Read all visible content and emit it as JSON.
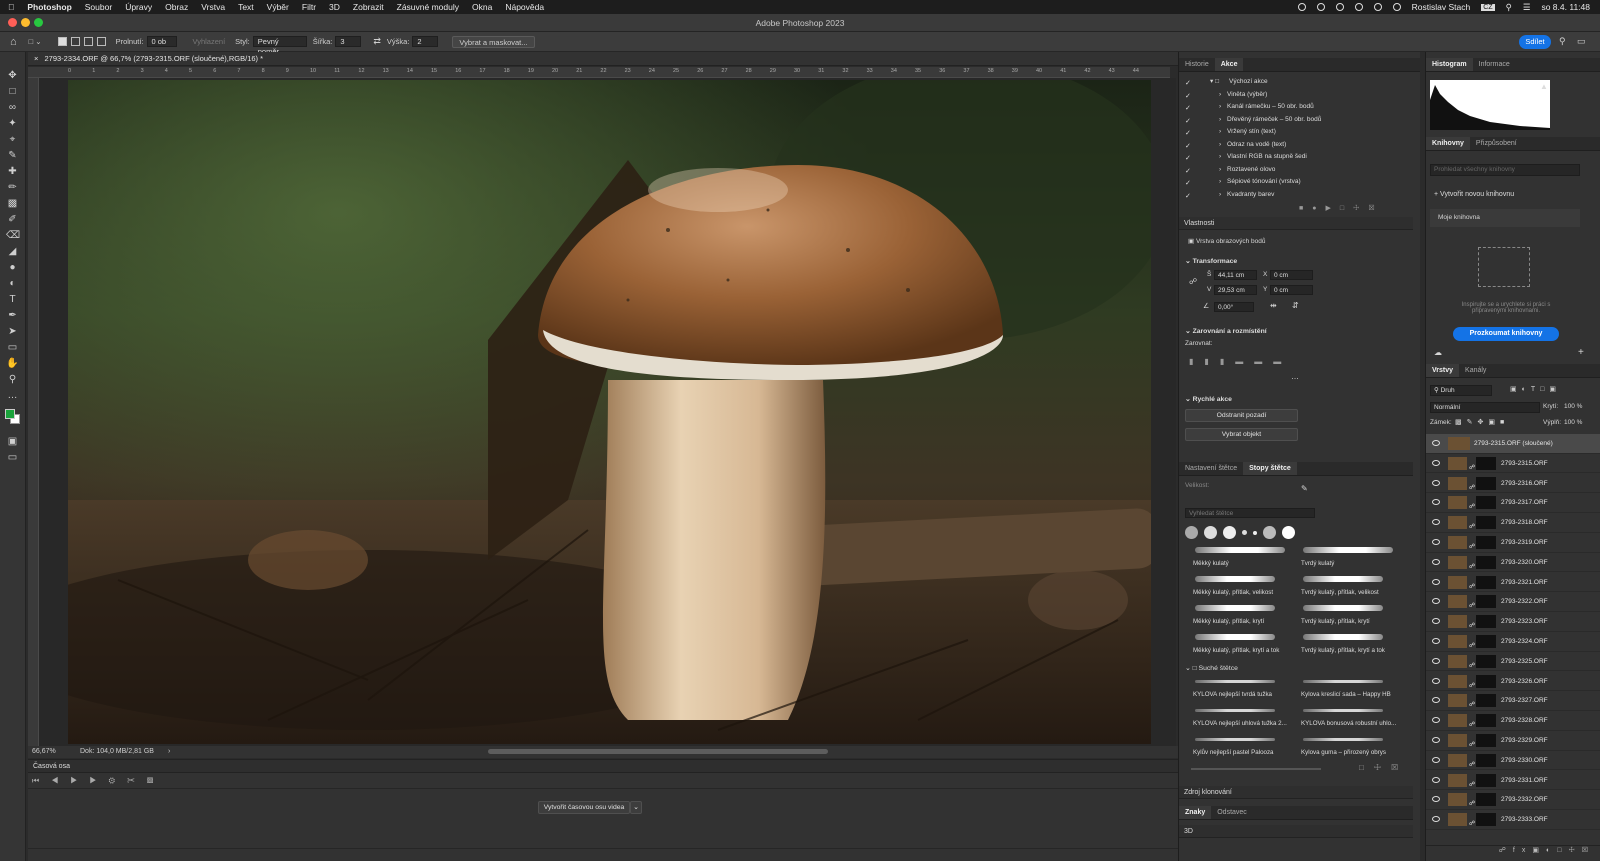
{
  "menubar": {
    "app": "Photoshop",
    "items": [
      "Soubor",
      "Úpravy",
      "Obraz",
      "Vrstva",
      "Text",
      "Výběr",
      "Filtr",
      "3D",
      "Zobrazit",
      "Zásuvné moduly",
      "Okna",
      "Nápověda"
    ],
    "user": "Rostislav Stach",
    "lang": "CZ",
    "datetime": "so 8.4.  11:48"
  },
  "window": {
    "title": "Adobe Photoshop 2023"
  },
  "options": {
    "feather_label": "Prolnutí:",
    "feather_value": "0 ob",
    "antialias_label": "Vyhlazení",
    "style_label": "Styl:",
    "style_value": "Pevný poměr",
    "width_label": "Šířka:",
    "width_value": "3",
    "height_label": "Výška:",
    "height_value": "2",
    "select_mask": "Vybrat a maskovat...",
    "share": "Sdílet"
  },
  "document": {
    "tab": "2793-2334.ORF @ 66,7% (2793-2315.ORF (sloučené),RGB/16) *",
    "zoom": "66,67%",
    "doc_info": "Dok: 104,0 MB/2,81 GB"
  },
  "ruler_ticks": [
    "0",
    "1",
    "2",
    "3",
    "4",
    "5",
    "6",
    "7",
    "8",
    "9",
    "10",
    "11",
    "12",
    "13",
    "14",
    "15",
    "16",
    "17",
    "18",
    "19",
    "20",
    "21",
    "22",
    "23",
    "24",
    "25",
    "26",
    "27",
    "28",
    "29",
    "30",
    "31",
    "32",
    "33",
    "34",
    "35",
    "36",
    "37",
    "38",
    "39",
    "40",
    "41",
    "42",
    "43",
    "44"
  ],
  "timeline": {
    "title": "Časová osa",
    "create_button": "Vytvořit časovou osu videa"
  },
  "history_actions": {
    "tabs": [
      "Historie",
      "Akce"
    ],
    "set_name": "Výchozí akce",
    "actions": [
      "Viněta (výběr)",
      "Kanál rámečku – 50 obr. bodů",
      "Dřevěný rámeček – 50 obr. bodů",
      "Vržený stín (text)",
      "Odraz na vodě (text)",
      "Vlastní RGB na stupně šedi",
      "Roztavené olovo",
      "Sépiové tónování (vrstva)",
      "Kvadranty barev"
    ]
  },
  "properties": {
    "title": "Vlastnosti",
    "layer_type": "Vrstva obrazových bodů",
    "transform_title": "Transformace",
    "w_label": "Š",
    "w_value": "44,11 cm",
    "x_label": "X",
    "x_value": "0 cm",
    "h_label": "V",
    "h_value": "29,53 cm",
    "y_label": "Y",
    "y_value": "0 cm",
    "angle_value": "0,00°",
    "align_title": "Zarovnání a rozmístění",
    "align_label": "Zarovnat:",
    "quick_title": "Rychlé akce",
    "quick_btn1": "Odstranit pozadí",
    "quick_btn2": "Vybrat objekt"
  },
  "brushes": {
    "tabs": [
      "Nastavení štětce",
      "Stopy štětce"
    ],
    "size_label": "Velikost:",
    "search_placeholder": "Vyhledat štětce",
    "items": [
      "Měkký kulatý",
      "Tvrdý kulatý",
      "Měkký kulatý, přítlak, velikost",
      "Tvrdý kulatý, přítlak, velikost",
      "Měkký kulatý, přítlak, krytí",
      "Tvrdý kulatý, přítlak, krytí",
      "Měkký kulatý, přítlak, krytí a tok",
      "Tvrdý kulatý, přítlak, krytí a tok"
    ],
    "group": "Suché štětce",
    "dry_items": [
      "KYLOVA nejlepší tvrdá tužka",
      "Kylova kreslicí sada – Happy HB",
      "KYLOVA nejlepší uhlová tužka 2...",
      "KYLOVA bonusová robustní uhlo...",
      "Kylův nejlepší pastel Palooza",
      "Kylova guma – přirozený obrys"
    ]
  },
  "clone": {
    "title": "Zdroj klonování"
  },
  "chars": {
    "tabs": [
      "Znaky",
      "Odstavec"
    ],
    "three_d": "3D"
  },
  "histogram": {
    "tabs": [
      "Histogram",
      "Informace"
    ]
  },
  "libraries": {
    "tabs": [
      "Knihovny",
      "Přizpůsobení"
    ],
    "search_placeholder": "Prohledat všechny knihovny",
    "new_library": "Vytvořit novou knihovnu",
    "my_library": "Moje knihovna",
    "hint": "Inspirujte se a urychlete si práci s připravenými knihovnami.",
    "explore": "Prozkoumat knihovny"
  },
  "layers_panel": {
    "tabs": [
      "Vrstvy",
      "Kanály"
    ],
    "filter": "Druh",
    "blend": "Normální",
    "opacity_label": "Krytí:",
    "opacity": "100 %",
    "lock_label": "Zámek:",
    "fill_label": "Výplň:",
    "fill": "100 %",
    "layers": [
      "2793-2315.ORF (sloučené)",
      "2793-2315.ORF",
      "2793-2316.ORF",
      "2793-2317.ORF",
      "2793-2318.ORF",
      "2793-2319.ORF",
      "2793-2320.ORF",
      "2793-2321.ORF",
      "2793-2322.ORF",
      "2793-2323.ORF",
      "2793-2324.ORF",
      "2793-2325.ORF",
      "2793-2326.ORF",
      "2793-2327.ORF",
      "2793-2328.ORF",
      "2793-2329.ORF",
      "2793-2330.ORF",
      "2793-2331.ORF",
      "2793-2332.ORF",
      "2793-2333.ORF"
    ]
  },
  "colors": {
    "accent": "#1473e6",
    "fg_swatch": "#1aa33b",
    "bg_swatch": "#ffffff"
  }
}
